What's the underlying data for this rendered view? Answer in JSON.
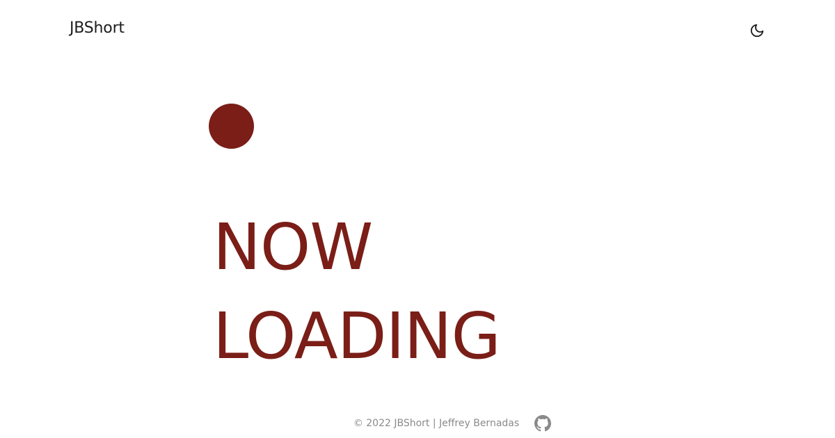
{
  "header": {
    "brand": "JBShort",
    "theme_toggle_icon": "moon-icon"
  },
  "main": {
    "loader_icon": "loading-dot",
    "loading_line_1": "NOW",
    "loading_line_2": "LOADING"
  },
  "footer": {
    "copyright": "© 2022 JBShort | Jeffrey Bernadas",
    "github_icon": "github-icon"
  },
  "colors": {
    "accent": "#7a1e17",
    "text": "#1c1c1c",
    "muted": "#8a8a8a",
    "background": "#ffffff"
  }
}
